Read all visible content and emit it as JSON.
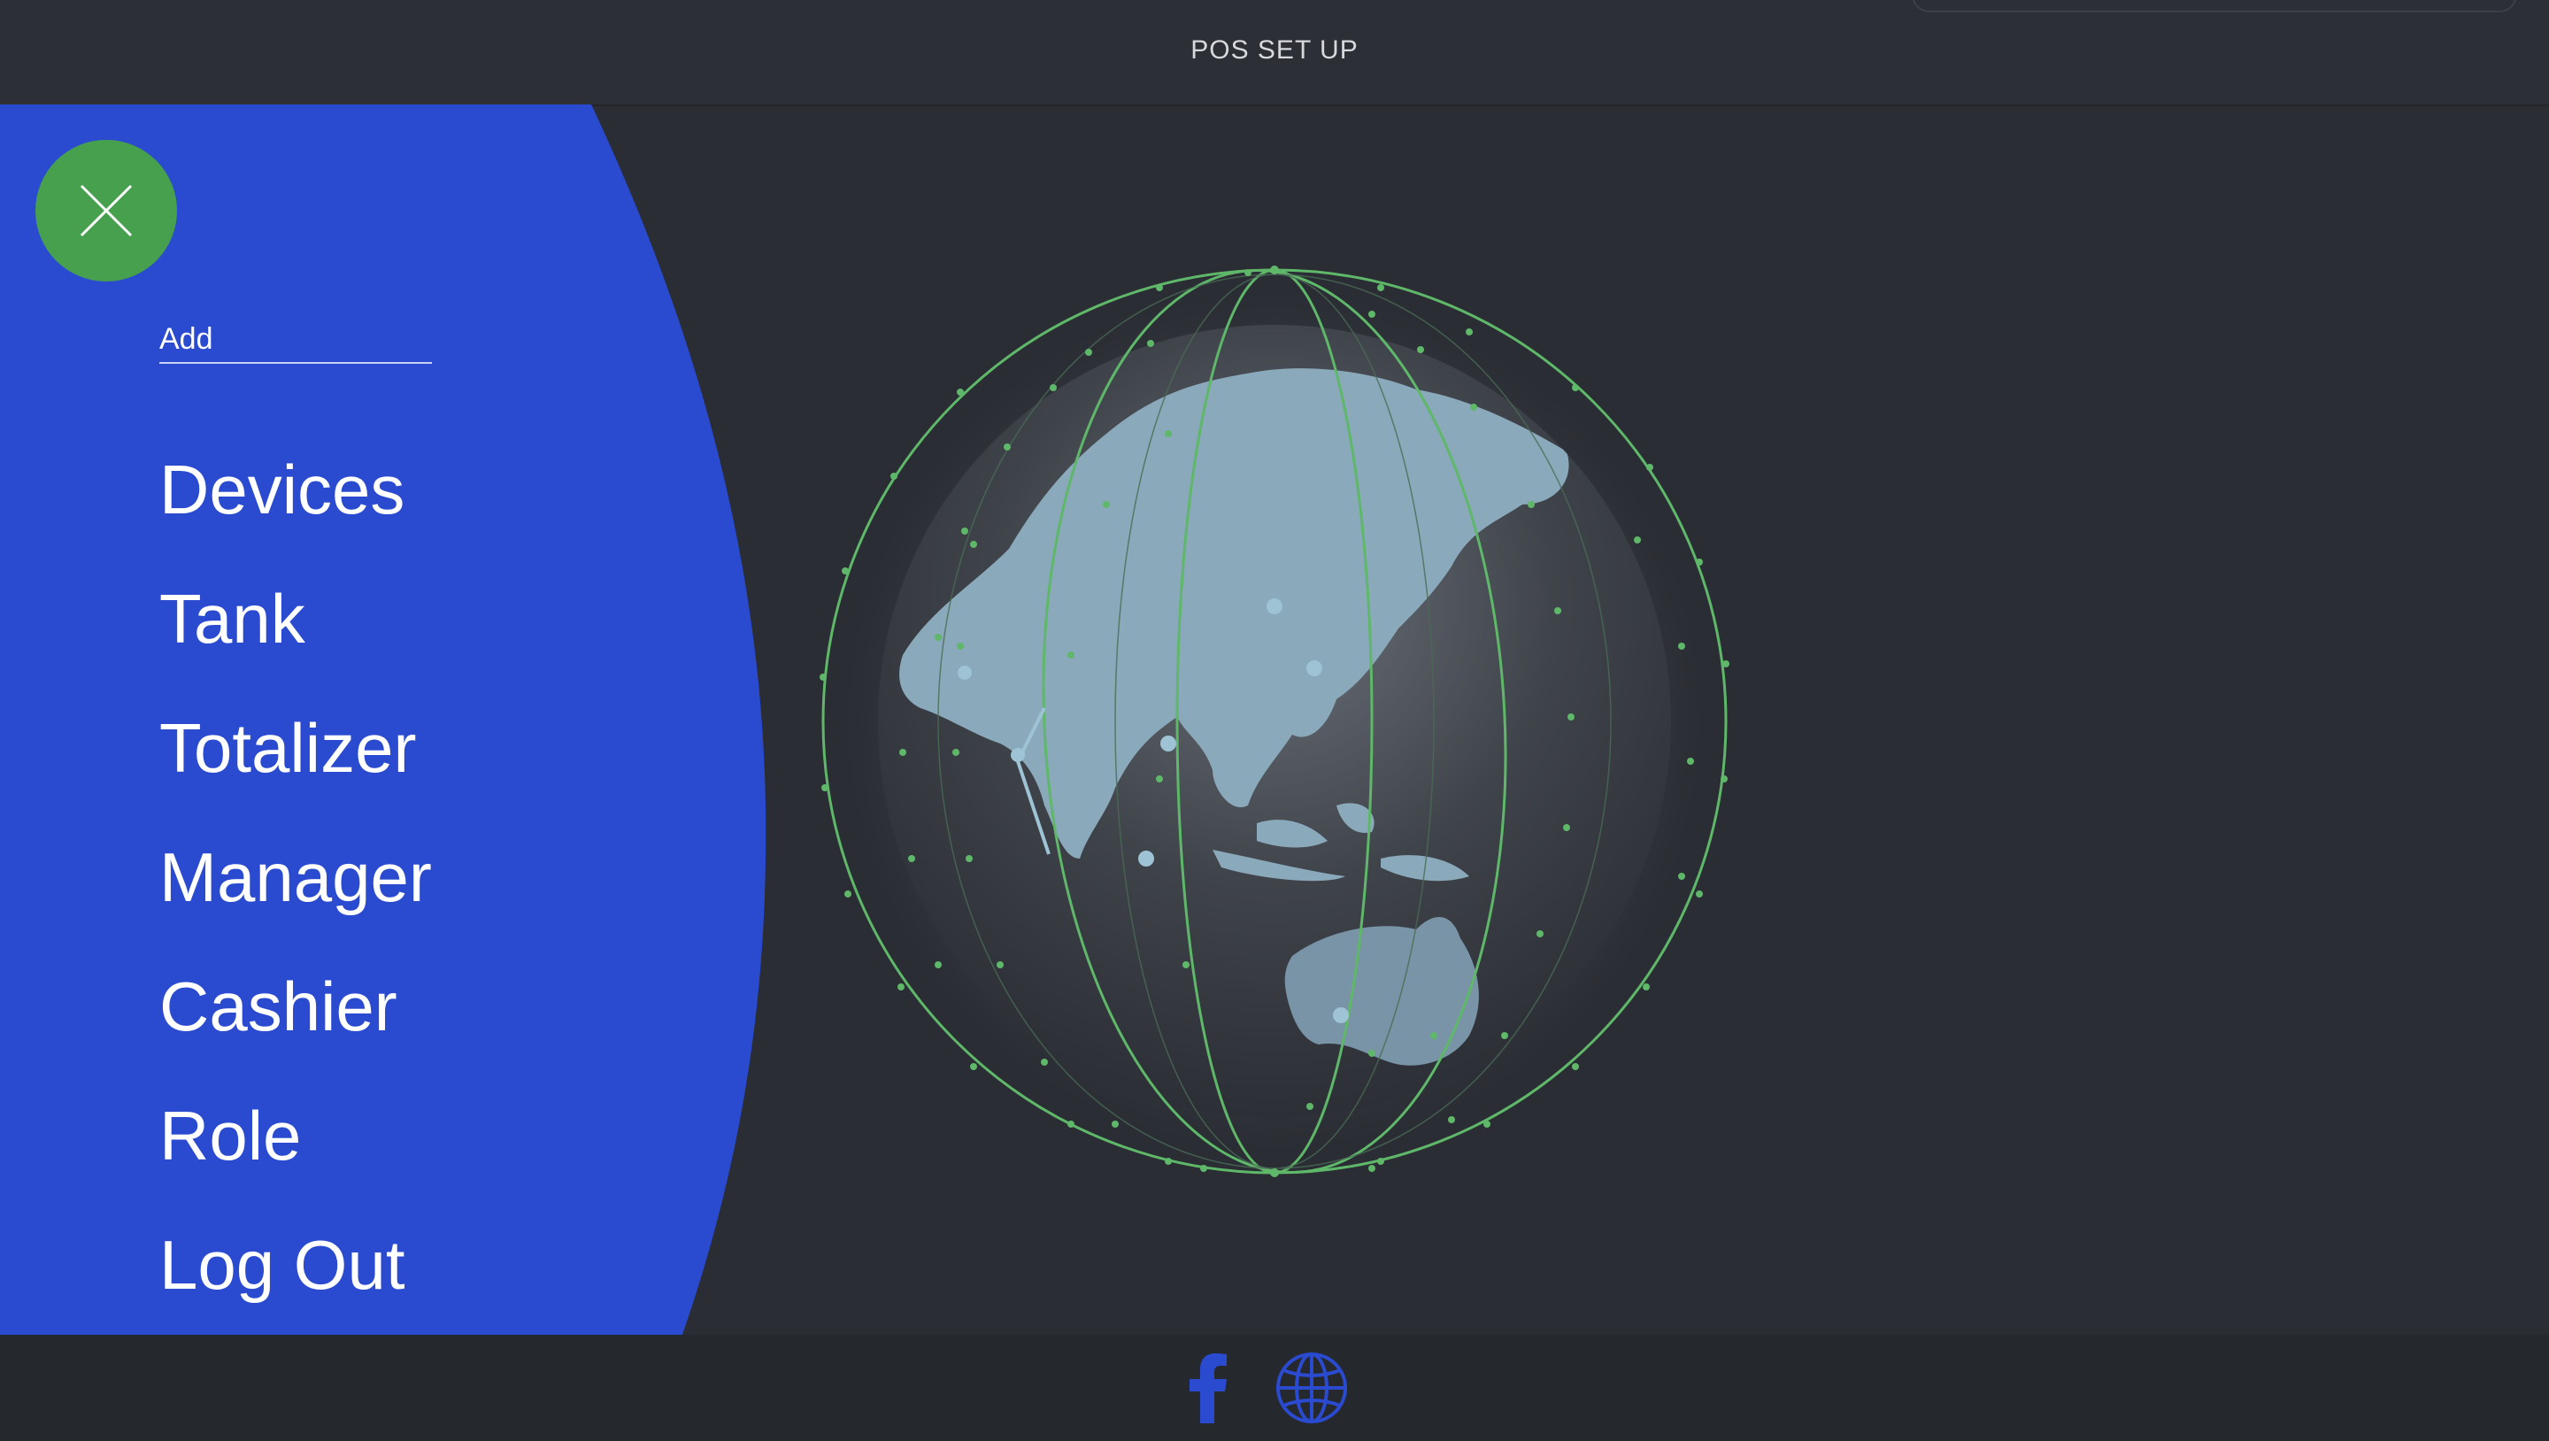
{
  "header": {
    "title": "POS SET UP"
  },
  "drawer": {
    "add_label": "Add",
    "menu_items": [
      {
        "label": "Devices"
      },
      {
        "label": "Tank"
      },
      {
        "label": "Totalizer"
      },
      {
        "label": "Manager"
      },
      {
        "label": "Cashier"
      },
      {
        "label": "Role"
      },
      {
        "label": "Log Out"
      }
    ]
  },
  "footer": {
    "icons": [
      "facebook-icon",
      "website-globe-icon"
    ]
  },
  "colors": {
    "background": "#2a2d33",
    "drawer": "#2a4bd0",
    "close_button": "#46a04e",
    "footer_icon": "#2a4bd0",
    "globe_land": "#8aa9bb",
    "orbit": "#5fb86a"
  }
}
